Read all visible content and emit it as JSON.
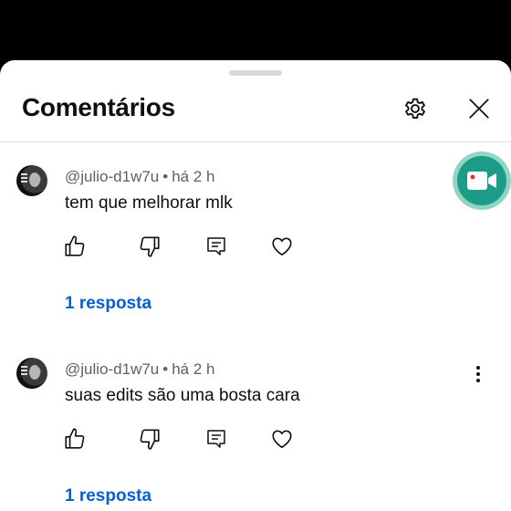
{
  "header": {
    "title": "Comentários"
  },
  "comments": [
    {
      "author": "@julio-d1w7u",
      "separator": "•",
      "time": "há 2 h",
      "text": "tem que melhorar mlk",
      "replies": "1 resposta"
    },
    {
      "author": "@julio-d1w7u",
      "separator": "•",
      "time": "há 2 h",
      "text": "suas edits são uma bosta cara",
      "replies": "1 resposta"
    }
  ],
  "icons": {
    "settings": "gear-icon",
    "close": "close-icon",
    "like": "thumbs-up-icon",
    "dislike": "thumbs-down-icon",
    "reply": "reply-comment-icon",
    "heart": "heart-icon",
    "more": "more-vertical-icon",
    "recorder": "video-camera-icon"
  },
  "colors": {
    "link": "#065fd4",
    "meta": "#606060",
    "recorder": "#1c9c88"
  }
}
